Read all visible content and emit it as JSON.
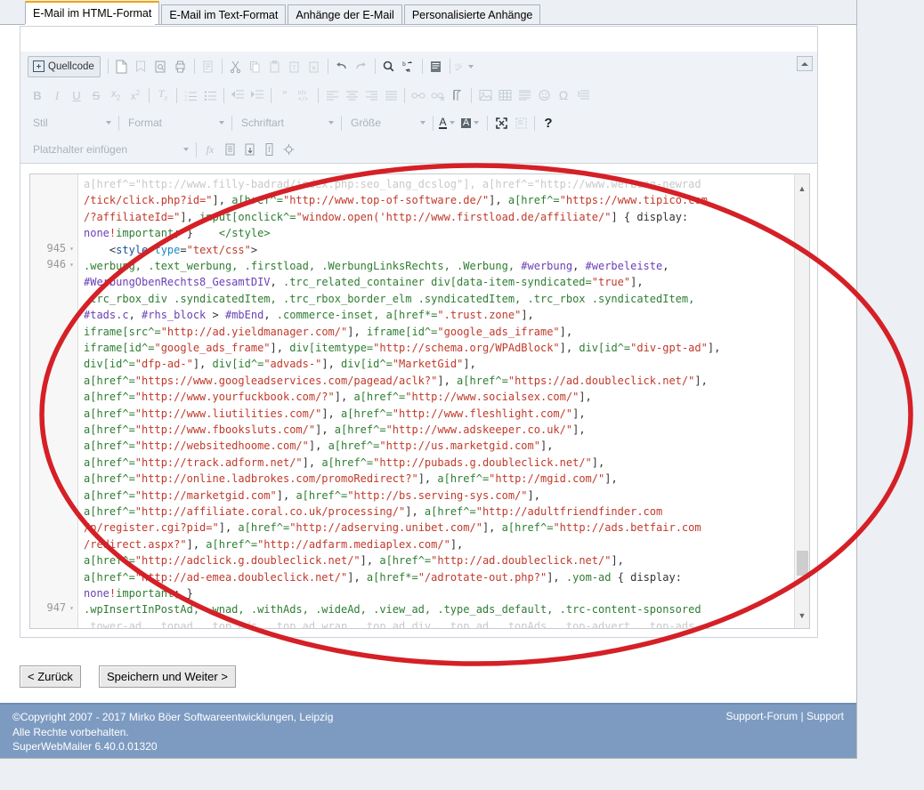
{
  "window": {
    "tabs": [
      {
        "label": "E-Mail im HTML-Format",
        "active": true
      },
      {
        "label": "E-Mail im Text-Format",
        "active": false
      },
      {
        "label": "Anhänge der E-Mail",
        "active": false
      },
      {
        "label": "Personalisierte Anhänge",
        "active": false
      }
    ]
  },
  "editor": {
    "source_button": "Quellcode",
    "toolbar_row1_icons": [
      "new-page-icon",
      "templates-icon",
      "preview-icon",
      "print-icon",
      "document-icon",
      "cut-icon",
      "copy-icon",
      "paste-icon",
      "paste-text-icon",
      "paste-word-icon",
      "undo-icon",
      "redo-icon",
      "find-icon",
      "replace-icon",
      "select-all-icon",
      "spellcheck-icon"
    ],
    "toolbar_row2_icons": [
      "bold-icon",
      "italic-icon",
      "underline-icon",
      "strikethrough-icon",
      "subscript-icon",
      "superscript-icon",
      "remove-format-icon",
      "numbered-list-icon",
      "bulleted-list-icon",
      "decrease-indent-icon",
      "increase-indent-icon",
      "blockquote-icon",
      "div-container-icon",
      "align-left-icon",
      "align-center-icon",
      "align-right-icon",
      "justify-icon",
      "link-icon",
      "unlink-icon",
      "anchor-icon",
      "image-icon",
      "table-icon",
      "horizontal-rule-icon",
      "smiley-icon",
      "special-char-icon",
      "page-break-icon"
    ],
    "dropdowns": [
      {
        "name": "stil",
        "label": "Stil"
      },
      {
        "name": "format",
        "label": "Format"
      },
      {
        "name": "schriftart",
        "label": "Schriftart"
      },
      {
        "name": "groesse",
        "label": "Größe"
      }
    ],
    "row3_icons": [
      "text-color-icon",
      "background-color-icon",
      "maximize-icon",
      "show-blocks-icon",
      "help-icon"
    ],
    "placeholder_dropdown": "Platzhalter einfügen",
    "row4_icons": [
      "function-icon",
      "document-insert-icon",
      "export-icon",
      "facebook-icon",
      "target-icon"
    ],
    "collapse_toolbar": "collapse-toolbar-button"
  },
  "code": {
    "line_numbers": [
      {
        "num": "945",
        "fold": "▾"
      },
      {
        "num": "946",
        "fold": "▾"
      },
      {
        "num": "947",
        "fold": "▾"
      }
    ],
    "lines": [
      {
        "y": 0,
        "clipped": true,
        "parts": [
          {
            "t": "a[href^=\"http://www.filly-badrad/index.php:seo_lang_dcslog\"], a[href^=\"http://www.werbung-newrad",
            "c": "clipped"
          }
        ]
      },
      {
        "y": 1,
        "parts": [
          {
            "t": "/tick/click.php?id=\"",
            "c": "str"
          },
          {
            "t": "], ",
            "c": "plain"
          },
          {
            "t": "a[href^=",
            "c": "sel"
          },
          {
            "t": "\"http://www.top-of-software.de/\"",
            "c": "str"
          },
          {
            "t": "], ",
            "c": "plain"
          },
          {
            "t": "a[href^=",
            "c": "sel"
          },
          {
            "t": "\"https://www.tipico.com",
            "c": "str"
          }
        ]
      },
      {
        "y": 2,
        "parts": [
          {
            "t": "/?affiliateId=\"",
            "c": "str"
          },
          {
            "t": "], ",
            "c": "plain"
          },
          {
            "t": "input[onclick^=",
            "c": "sel"
          },
          {
            "t": "\"window.open('http://www.firstload.de/affiliate/\"",
            "c": "str"
          },
          {
            "t": "] { display:",
            "c": "plain"
          }
        ]
      },
      {
        "y": 3,
        "parts": [
          {
            "t": "none",
            "c": "idsel"
          },
          {
            "t": "!",
            "c": "str"
          },
          {
            "t": "important",
            "c": "sel"
          },
          {
            "t": "; }    ",
            "c": "plain"
          },
          {
            "t": "</style>",
            "c": "sel"
          }
        ]
      },
      {
        "y": 4,
        "ln": "945",
        "parts": [
          {
            "t": "    <",
            "c": "plain"
          },
          {
            "t": "style",
            "c": "tag"
          },
          {
            "t": " ",
            "c": "plain"
          },
          {
            "t": "type",
            "c": "attr"
          },
          {
            "t": "=",
            "c": "plain"
          },
          {
            "t": "\"text/css\"",
            "c": "str"
          },
          {
            "t": ">",
            "c": "plain"
          }
        ]
      },
      {
        "y": 5,
        "ln": "946",
        "parts": [
          {
            "t": ".werbung, .text_werbung, .firstload, .WerbungLinksRechts, .Werbung, ",
            "c": "sel"
          },
          {
            "t": "#werbung",
            "c": "idsel"
          },
          {
            "t": ", ",
            "c": "plain"
          },
          {
            "t": "#werbeleiste",
            "c": "idsel"
          },
          {
            "t": ",",
            "c": "plain"
          }
        ]
      },
      {
        "y": 6,
        "parts": [
          {
            "t": "#WerbungObenRechts8_GesamtDIV",
            "c": "idsel"
          },
          {
            "t": ", ",
            "c": "plain"
          },
          {
            "t": ".trc_related_container div[data-item-syndicated=",
            "c": "sel"
          },
          {
            "t": "\"true\"",
            "c": "str"
          },
          {
            "t": "],",
            "c": "plain"
          }
        ]
      },
      {
        "y": 7,
        "parts": [
          {
            "t": ".trc_rbox_div .syndicatedItem, .trc_rbox_border_elm .syndicatedItem, .trc_rbox .syndicatedItem,",
            "c": "sel"
          }
        ]
      },
      {
        "y": 8,
        "parts": [
          {
            "t": "#tads.c",
            "c": "idsel"
          },
          {
            "t": ", ",
            "c": "plain"
          },
          {
            "t": "#rhs_block",
            "c": "idsel"
          },
          {
            "t": " > ",
            "c": "plain"
          },
          {
            "t": "#mbEnd",
            "c": "idsel"
          },
          {
            "t": ", ",
            "c": "plain"
          },
          {
            "t": ".commerce-inset, a[href*=",
            "c": "sel"
          },
          {
            "t": "\".trust.zone\"",
            "c": "str"
          },
          {
            "t": "],",
            "c": "plain"
          }
        ]
      },
      {
        "y": 9,
        "parts": [
          {
            "t": "iframe[src^=",
            "c": "sel"
          },
          {
            "t": "\"http://ad.yieldmanager.com/\"",
            "c": "str"
          },
          {
            "t": "], ",
            "c": "plain"
          },
          {
            "t": "iframe[id^=",
            "c": "sel"
          },
          {
            "t": "\"google_ads_iframe\"",
            "c": "str"
          },
          {
            "t": "],",
            "c": "plain"
          }
        ]
      },
      {
        "y": 10,
        "parts": [
          {
            "t": "iframe[id^=",
            "c": "sel"
          },
          {
            "t": "\"google_ads_frame\"",
            "c": "str"
          },
          {
            "t": "], ",
            "c": "plain"
          },
          {
            "t": "div[itemtype=",
            "c": "sel"
          },
          {
            "t": "\"http://schema.org/WPAdBlock\"",
            "c": "str"
          },
          {
            "t": "], ",
            "c": "plain"
          },
          {
            "t": "div[id^=",
            "c": "sel"
          },
          {
            "t": "\"div-gpt-ad\"",
            "c": "str"
          },
          {
            "t": "],",
            "c": "plain"
          }
        ]
      },
      {
        "y": 11,
        "parts": [
          {
            "t": "div[id^=",
            "c": "sel"
          },
          {
            "t": "\"dfp-ad-\"",
            "c": "str"
          },
          {
            "t": "], ",
            "c": "plain"
          },
          {
            "t": "div[id^=",
            "c": "sel"
          },
          {
            "t": "\"advads-\"",
            "c": "str"
          },
          {
            "t": "], ",
            "c": "plain"
          },
          {
            "t": "div[id^=",
            "c": "sel"
          },
          {
            "t": "\"MarketGid\"",
            "c": "str"
          },
          {
            "t": "],",
            "c": "plain"
          }
        ]
      },
      {
        "y": 12,
        "parts": [
          {
            "t": "a[href^=",
            "c": "sel"
          },
          {
            "t": "\"https://www.googleadservices.com/pagead/aclk?\"",
            "c": "str"
          },
          {
            "t": "], ",
            "c": "plain"
          },
          {
            "t": "a[href^=",
            "c": "sel"
          },
          {
            "t": "\"https://ad.doubleclick.net/\"",
            "c": "str"
          },
          {
            "t": "],",
            "c": "plain"
          }
        ]
      },
      {
        "y": 13,
        "parts": [
          {
            "t": "a[href^=",
            "c": "sel"
          },
          {
            "t": "\"http://www.yourfuckbook.com/?\"",
            "c": "str"
          },
          {
            "t": "], ",
            "c": "plain"
          },
          {
            "t": "a[href^=",
            "c": "sel"
          },
          {
            "t": "\"http://www.socialsex.com/\"",
            "c": "str"
          },
          {
            "t": "],",
            "c": "plain"
          }
        ]
      },
      {
        "y": 14,
        "parts": [
          {
            "t": "a[href^=",
            "c": "sel"
          },
          {
            "t": "\"http://www.liutilities.com/\"",
            "c": "str"
          },
          {
            "t": "], ",
            "c": "plain"
          },
          {
            "t": "a[href^=",
            "c": "sel"
          },
          {
            "t": "\"http://www.fleshlight.com/\"",
            "c": "str"
          },
          {
            "t": "],",
            "c": "plain"
          }
        ]
      },
      {
        "y": 15,
        "parts": [
          {
            "t": "a[href^=",
            "c": "sel"
          },
          {
            "t": "\"http://www.fbooksluts.com/\"",
            "c": "str"
          },
          {
            "t": "], ",
            "c": "plain"
          },
          {
            "t": "a[href^=",
            "c": "sel"
          },
          {
            "t": "\"http://www.adskeeper.co.uk/\"",
            "c": "str"
          },
          {
            "t": "],",
            "c": "plain"
          }
        ]
      },
      {
        "y": 16,
        "parts": [
          {
            "t": "a[href^=",
            "c": "sel"
          },
          {
            "t": "\"http://websitedhoome.com/\"",
            "c": "str"
          },
          {
            "t": "], ",
            "c": "plain"
          },
          {
            "t": "a[href^=",
            "c": "sel"
          },
          {
            "t": "\"http://us.marketgid.com\"",
            "c": "str"
          },
          {
            "t": "],",
            "c": "plain"
          }
        ]
      },
      {
        "y": 17,
        "parts": [
          {
            "t": "a[href^=",
            "c": "sel"
          },
          {
            "t": "\"http://track.adform.net/\"",
            "c": "str"
          },
          {
            "t": "], ",
            "c": "plain"
          },
          {
            "t": "a[href^=",
            "c": "sel"
          },
          {
            "t": "\"http://pubads.g.doubleclick.net/\"",
            "c": "str"
          },
          {
            "t": "],",
            "c": "plain"
          }
        ]
      },
      {
        "y": 18,
        "parts": [
          {
            "t": "a[href^=",
            "c": "sel"
          },
          {
            "t": "\"http://online.ladbrokes.com/promoRedirect?\"",
            "c": "str"
          },
          {
            "t": "], ",
            "c": "plain"
          },
          {
            "t": "a[href^=",
            "c": "sel"
          },
          {
            "t": "\"http://mgid.com/\"",
            "c": "str"
          },
          {
            "t": "],",
            "c": "plain"
          }
        ]
      },
      {
        "y": 19,
        "parts": [
          {
            "t": "a[href^=",
            "c": "sel"
          },
          {
            "t": "\"http://marketgid.com\"",
            "c": "str"
          },
          {
            "t": "], ",
            "c": "plain"
          },
          {
            "t": "a[href^=",
            "c": "sel"
          },
          {
            "t": "\"http://bs.serving-sys.com/\"",
            "c": "str"
          },
          {
            "t": "],",
            "c": "plain"
          }
        ]
      },
      {
        "y": 20,
        "parts": [
          {
            "t": "a[href^=",
            "c": "sel"
          },
          {
            "t": "\"http://affiliate.coral.co.uk/processing/\"",
            "c": "str"
          },
          {
            "t": "], ",
            "c": "plain"
          },
          {
            "t": "a[href^=",
            "c": "sel"
          },
          {
            "t": "\"http://adultfriendfinder.com",
            "c": "str"
          }
        ]
      },
      {
        "y": 21,
        "parts": [
          {
            "t": "/p/register.cgi?pid=\"",
            "c": "str"
          },
          {
            "t": "], ",
            "c": "plain"
          },
          {
            "t": "a[href^=",
            "c": "sel"
          },
          {
            "t": "\"http://adserving.unibet.com/\"",
            "c": "str"
          },
          {
            "t": "], ",
            "c": "plain"
          },
          {
            "t": "a[href^=",
            "c": "sel"
          },
          {
            "t": "\"http://ads.betfair.com",
            "c": "str"
          }
        ]
      },
      {
        "y": 22,
        "parts": [
          {
            "t": "/redirect.aspx?\"",
            "c": "str"
          },
          {
            "t": "], ",
            "c": "plain"
          },
          {
            "t": "a[href^=",
            "c": "sel"
          },
          {
            "t": "\"http://adfarm.mediaplex.com/\"",
            "c": "str"
          },
          {
            "t": "],",
            "c": "plain"
          }
        ]
      },
      {
        "y": 23,
        "parts": [
          {
            "t": "a[href^=",
            "c": "sel"
          },
          {
            "t": "\"http://adclick.g.doubleclick.net/\"",
            "c": "str"
          },
          {
            "t": "], ",
            "c": "plain"
          },
          {
            "t": "a[href^=",
            "c": "sel"
          },
          {
            "t": "\"http://ad.doubleclick.net/\"",
            "c": "str"
          },
          {
            "t": "],",
            "c": "plain"
          }
        ]
      },
      {
        "y": 24,
        "parts": [
          {
            "t": "a[href^=",
            "c": "sel"
          },
          {
            "t": "\"http://ad-emea.doubleclick.net/\"",
            "c": "str"
          },
          {
            "t": "], ",
            "c": "plain"
          },
          {
            "t": "a[href*=",
            "c": "sel"
          },
          {
            "t": "\"/adrotate-out.php?\"",
            "c": "str"
          },
          {
            "t": "], ",
            "c": "plain"
          },
          {
            "t": ".yom-ad",
            "c": "sel"
          },
          {
            "t": " { display:",
            "c": "plain"
          }
        ]
      },
      {
        "y": 25,
        "parts": [
          {
            "t": "none",
            "c": "idsel"
          },
          {
            "t": "!",
            "c": "str"
          },
          {
            "t": "important",
            "c": "sel"
          },
          {
            "t": "; }",
            "c": "plain"
          }
        ]
      },
      {
        "y": 26,
        "ln": "947",
        "parts": [
          {
            "t": ".wpInsertInPostAd, .wnad, .withAds, .wideAd, .view_ad, .type_ads_default, .trc-content-sponsored",
            "c": "sel"
          }
        ]
      },
      {
        "y": 27,
        "clipped": true,
        "parts": [
          {
            "t": ".tower-ad, .topad, .top_ads, .top_ad_wrap, .top_ad_div, .top_ad, .topAds, .top-advert, .top-ads,",
            "c": "clipped"
          }
        ]
      }
    ]
  },
  "buttons": {
    "back": "< Zurück",
    "save_next": "Speichern und Weiter >"
  },
  "footer": {
    "copyright": "©Copyright 2007 - 2017 Mirko Böer Softwareentwicklungen, Leipzig",
    "rights": "Alle Rechte vorbehalten.",
    "version": "SuperWebMailer 6.40.0.01320",
    "support_forum": "Support-Forum",
    "separator": "|",
    "support": "Support"
  },
  "annotation": {
    "shape": "red-ellipse",
    "color": "#d42026"
  }
}
